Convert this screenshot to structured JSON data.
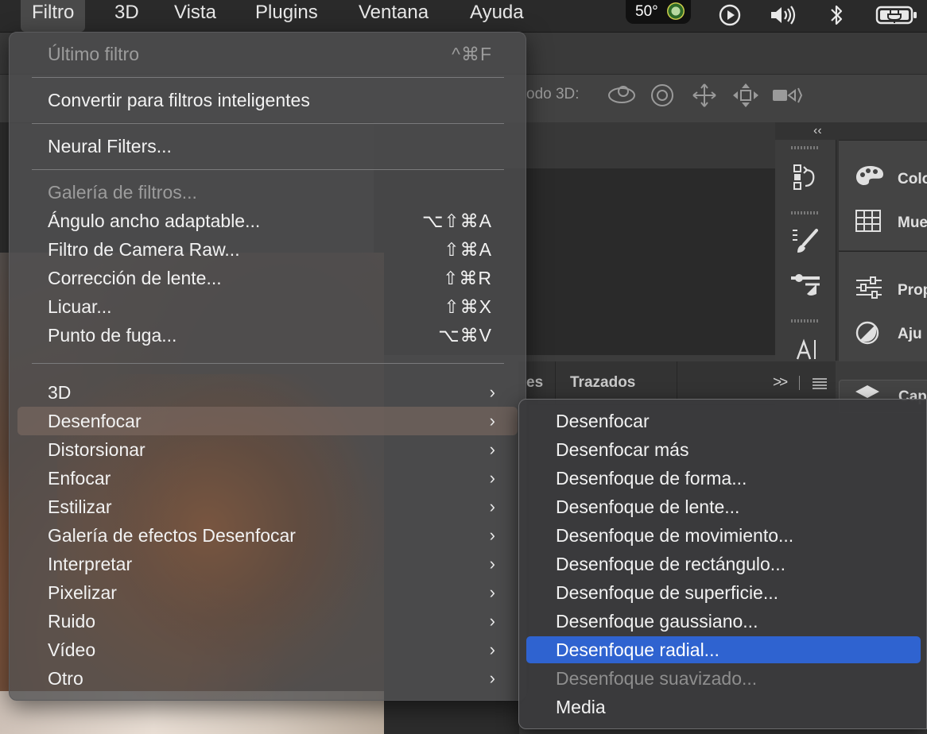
{
  "menubar": {
    "items": [
      "Filtro",
      "3D",
      "Vista",
      "Plugins",
      "Ventana",
      "Ayuda"
    ],
    "active_index": 0,
    "temperature": "50°"
  },
  "photoshop": {
    "options_mode_label": "odo 3D:",
    "panel_tab_partial": "es",
    "panel_tab": "Trazados",
    "dock_labels": [
      "Colo",
      "Mue",
      "Prop",
      "Aju",
      "Cap"
    ]
  },
  "filter_menu": {
    "items": [
      {
        "label": "Último filtro",
        "shortcut": "^⌘F",
        "disabled": true
      },
      {
        "label": "Convertir para filtros inteligentes"
      },
      {
        "label": "Neural Filters..."
      },
      {
        "label": "Galería de filtros...",
        "disabled": true
      },
      {
        "label": "Ángulo ancho adaptable...",
        "shortcut": "⌥⇧⌘A"
      },
      {
        "label": "Filtro de Camera Raw...",
        "shortcut": "⇧⌘A"
      },
      {
        "label": "Corrección de lente...",
        "shortcut": "⇧⌘R"
      },
      {
        "label": "Licuar...",
        "shortcut": "⇧⌘X"
      },
      {
        "label": "Punto de fuga...",
        "shortcut": "⌥⌘V"
      },
      {
        "label": "3D",
        "submenu": true
      },
      {
        "label": "Desenfocar",
        "submenu": true,
        "highlighted": true
      },
      {
        "label": "Distorsionar",
        "submenu": true
      },
      {
        "label": "Enfocar",
        "submenu": true
      },
      {
        "label": "Estilizar",
        "submenu": true
      },
      {
        "label": "Galería de efectos Desenfocar",
        "submenu": true
      },
      {
        "label": "Interpretar",
        "submenu": true
      },
      {
        "label": "Pixelizar",
        "submenu": true
      },
      {
        "label": "Ruido",
        "submenu": true
      },
      {
        "label": "Vídeo",
        "submenu": true
      },
      {
        "label": "Otro",
        "submenu": true
      }
    ],
    "submenu_arrow": "›"
  },
  "blur_submenu": {
    "items": [
      {
        "label": "Desenfocar"
      },
      {
        "label": "Desenfocar más"
      },
      {
        "label": "Desenfoque de forma..."
      },
      {
        "label": "Desenfoque de lente..."
      },
      {
        "label": "Desenfoque de movimiento..."
      },
      {
        "label": "Desenfoque de rectángulo..."
      },
      {
        "label": "Desenfoque de superficie..."
      },
      {
        "label": "Desenfoque gaussiano..."
      },
      {
        "label": "Desenfoque radial...",
        "selected": true
      },
      {
        "label": "Desenfoque suavizado...",
        "disabled": true
      },
      {
        "label": "Media"
      }
    ]
  },
  "colors": {
    "selection": "#2f63d0",
    "highlight": "#826e64"
  }
}
